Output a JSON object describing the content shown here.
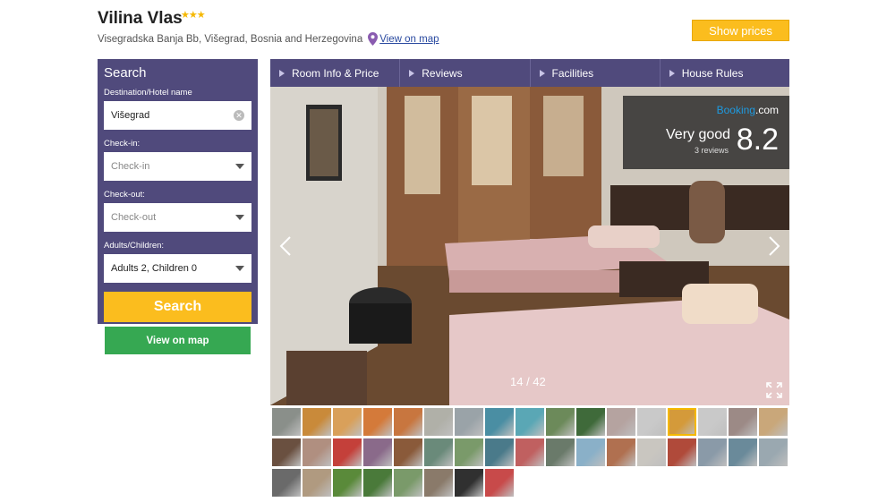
{
  "hotel": {
    "name": "Vilina Vlas",
    "stars": "★★★",
    "address": "Visegradska Banja Bb, Višegrad, Bosnia and Herzegovina",
    "map_link": "View on map",
    "show_prices_label": "Show prices"
  },
  "search": {
    "title": "Search",
    "destination_label": "Destination/Hotel name",
    "destination_value": "Višegrad",
    "checkin_label": "Check-in:",
    "checkin_placeholder": "Check-in",
    "checkout_label": "Check-out:",
    "checkout_placeholder": "Check-out",
    "guests_label": "Adults/Children:",
    "guests_value": "Adults 2, Children 0",
    "search_button": "Search",
    "view_on_map_button": "View on map"
  },
  "tabs": [
    {
      "label": "Room Info & Price"
    },
    {
      "label": "Reviews"
    },
    {
      "label": "Facilities"
    },
    {
      "label": "House Rules"
    }
  ],
  "rating": {
    "brand_part1": "Booking",
    "brand_part2": ".com",
    "verdict": "Very good",
    "reviews": "3 reviews",
    "score": "8.2"
  },
  "gallery": {
    "counter": "14 / 42",
    "current_index": 14,
    "total": 42,
    "thumb_colors": [
      "#8a8f8a",
      "#c98a3a",
      "#d9a05a",
      "#d47a3a",
      "#c8763f",
      "#b0b0a8",
      "#9aa3a8",
      "#4a8ea3",
      "#5aa7b5",
      "#6c8a5a",
      "#3f6a3a",
      "#b5a3a0",
      "#c9c9c9",
      "#d49a3a",
      "#c9c9c9",
      "#9c8a86",
      "#c9a77a",
      "#6a5040",
      "#b08f80",
      "#c4403a",
      "#8a6a8a",
      "#8a5a3a",
      "#6a8a7a",
      "#7a9a6a",
      "#4a7a8a",
      "#c06060",
      "#6a7a6a",
      "#8ab0c8",
      "#b07050",
      "#c9c6c0",
      "#b04a3a",
      "#8a9aa8",
      "#6a8a9a",
      "#9aa8b0",
      "#6a6a6a",
      "#b09a80",
      "#5a8a3a",
      "#4a7a3a",
      "#7a9a6a",
      "#8a7a6a",
      "#303030",
      "#c84a4a"
    ]
  }
}
